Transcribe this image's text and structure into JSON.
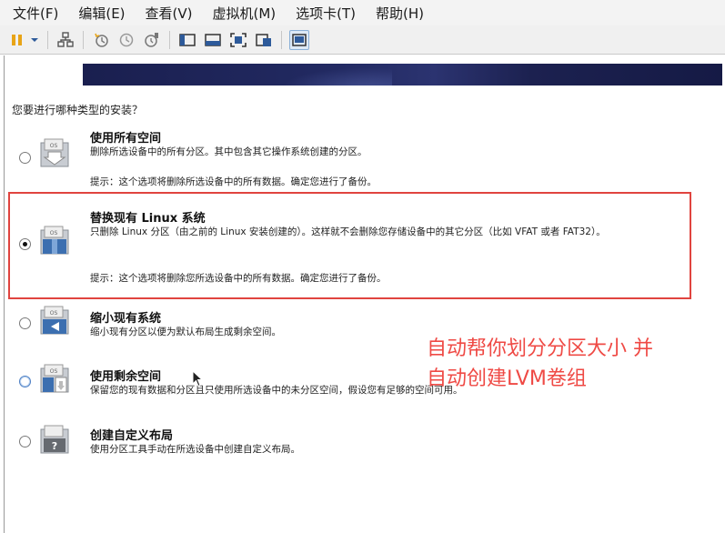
{
  "menu": [
    "文件(F)",
    "编辑(E)",
    "查看(V)",
    "虚拟机(M)",
    "选项卡(T)",
    "帮助(H)"
  ],
  "toolbar": {
    "icons": [
      "pause-icon",
      "dropdown-arrow-icon",
      "network-icon",
      "snapshot-icon",
      "revert-snapshot-icon",
      "snapshot-manager-icon",
      "sidebar-view-icon",
      "console-view-icon",
      "fullscreen-icon",
      "unity-icon",
      "thumbnail-view-icon"
    ],
    "accent": "#e8a417"
  },
  "installer": {
    "question": "您要进行哪种类型的安装？",
    "options": [
      {
        "title": "使用所有空间",
        "desc": "删除所选设备中的所有分区。其中包含其它操作系统创建的分区。",
        "tip": "提示：这个选项将删除所选设备中的所有数据。确定您进行了备份。",
        "selected": false
      },
      {
        "title": "替换现有 Linux 系统",
        "desc": "只删除 Linux 分区（由之前的 Linux 安装创建的）。这样就不会删除您存储设备中的其它分区（比如 VFAT 或者 FAT32）。",
        "tip": "提示：这个选项将删除您所选设备中的所有数据。确定您进行了备份。",
        "selected": true
      },
      {
        "title": "缩小现有系统",
        "desc": "缩小现有分区以便为默认布局生成剩余空间。",
        "tip": "",
        "selected": false
      },
      {
        "title": "使用剩余空间",
        "desc": "保留您的现有数据和分区且只使用所选设备中的未分区空间，假设您有足够的空间可用。",
        "tip": "",
        "selected": false
      },
      {
        "title": "创建自定义布局",
        "desc": "使用分区工具手动在所选设备中创建自定义布局。",
        "tip": "",
        "selected": false
      }
    ],
    "icon_label": "OS",
    "custom_icon_label": "?"
  },
  "annotation": {
    "line1": "自动帮你划分分区大小 并",
    "line2": "自动创建LVM卷组",
    "color": "#ef4a45"
  }
}
